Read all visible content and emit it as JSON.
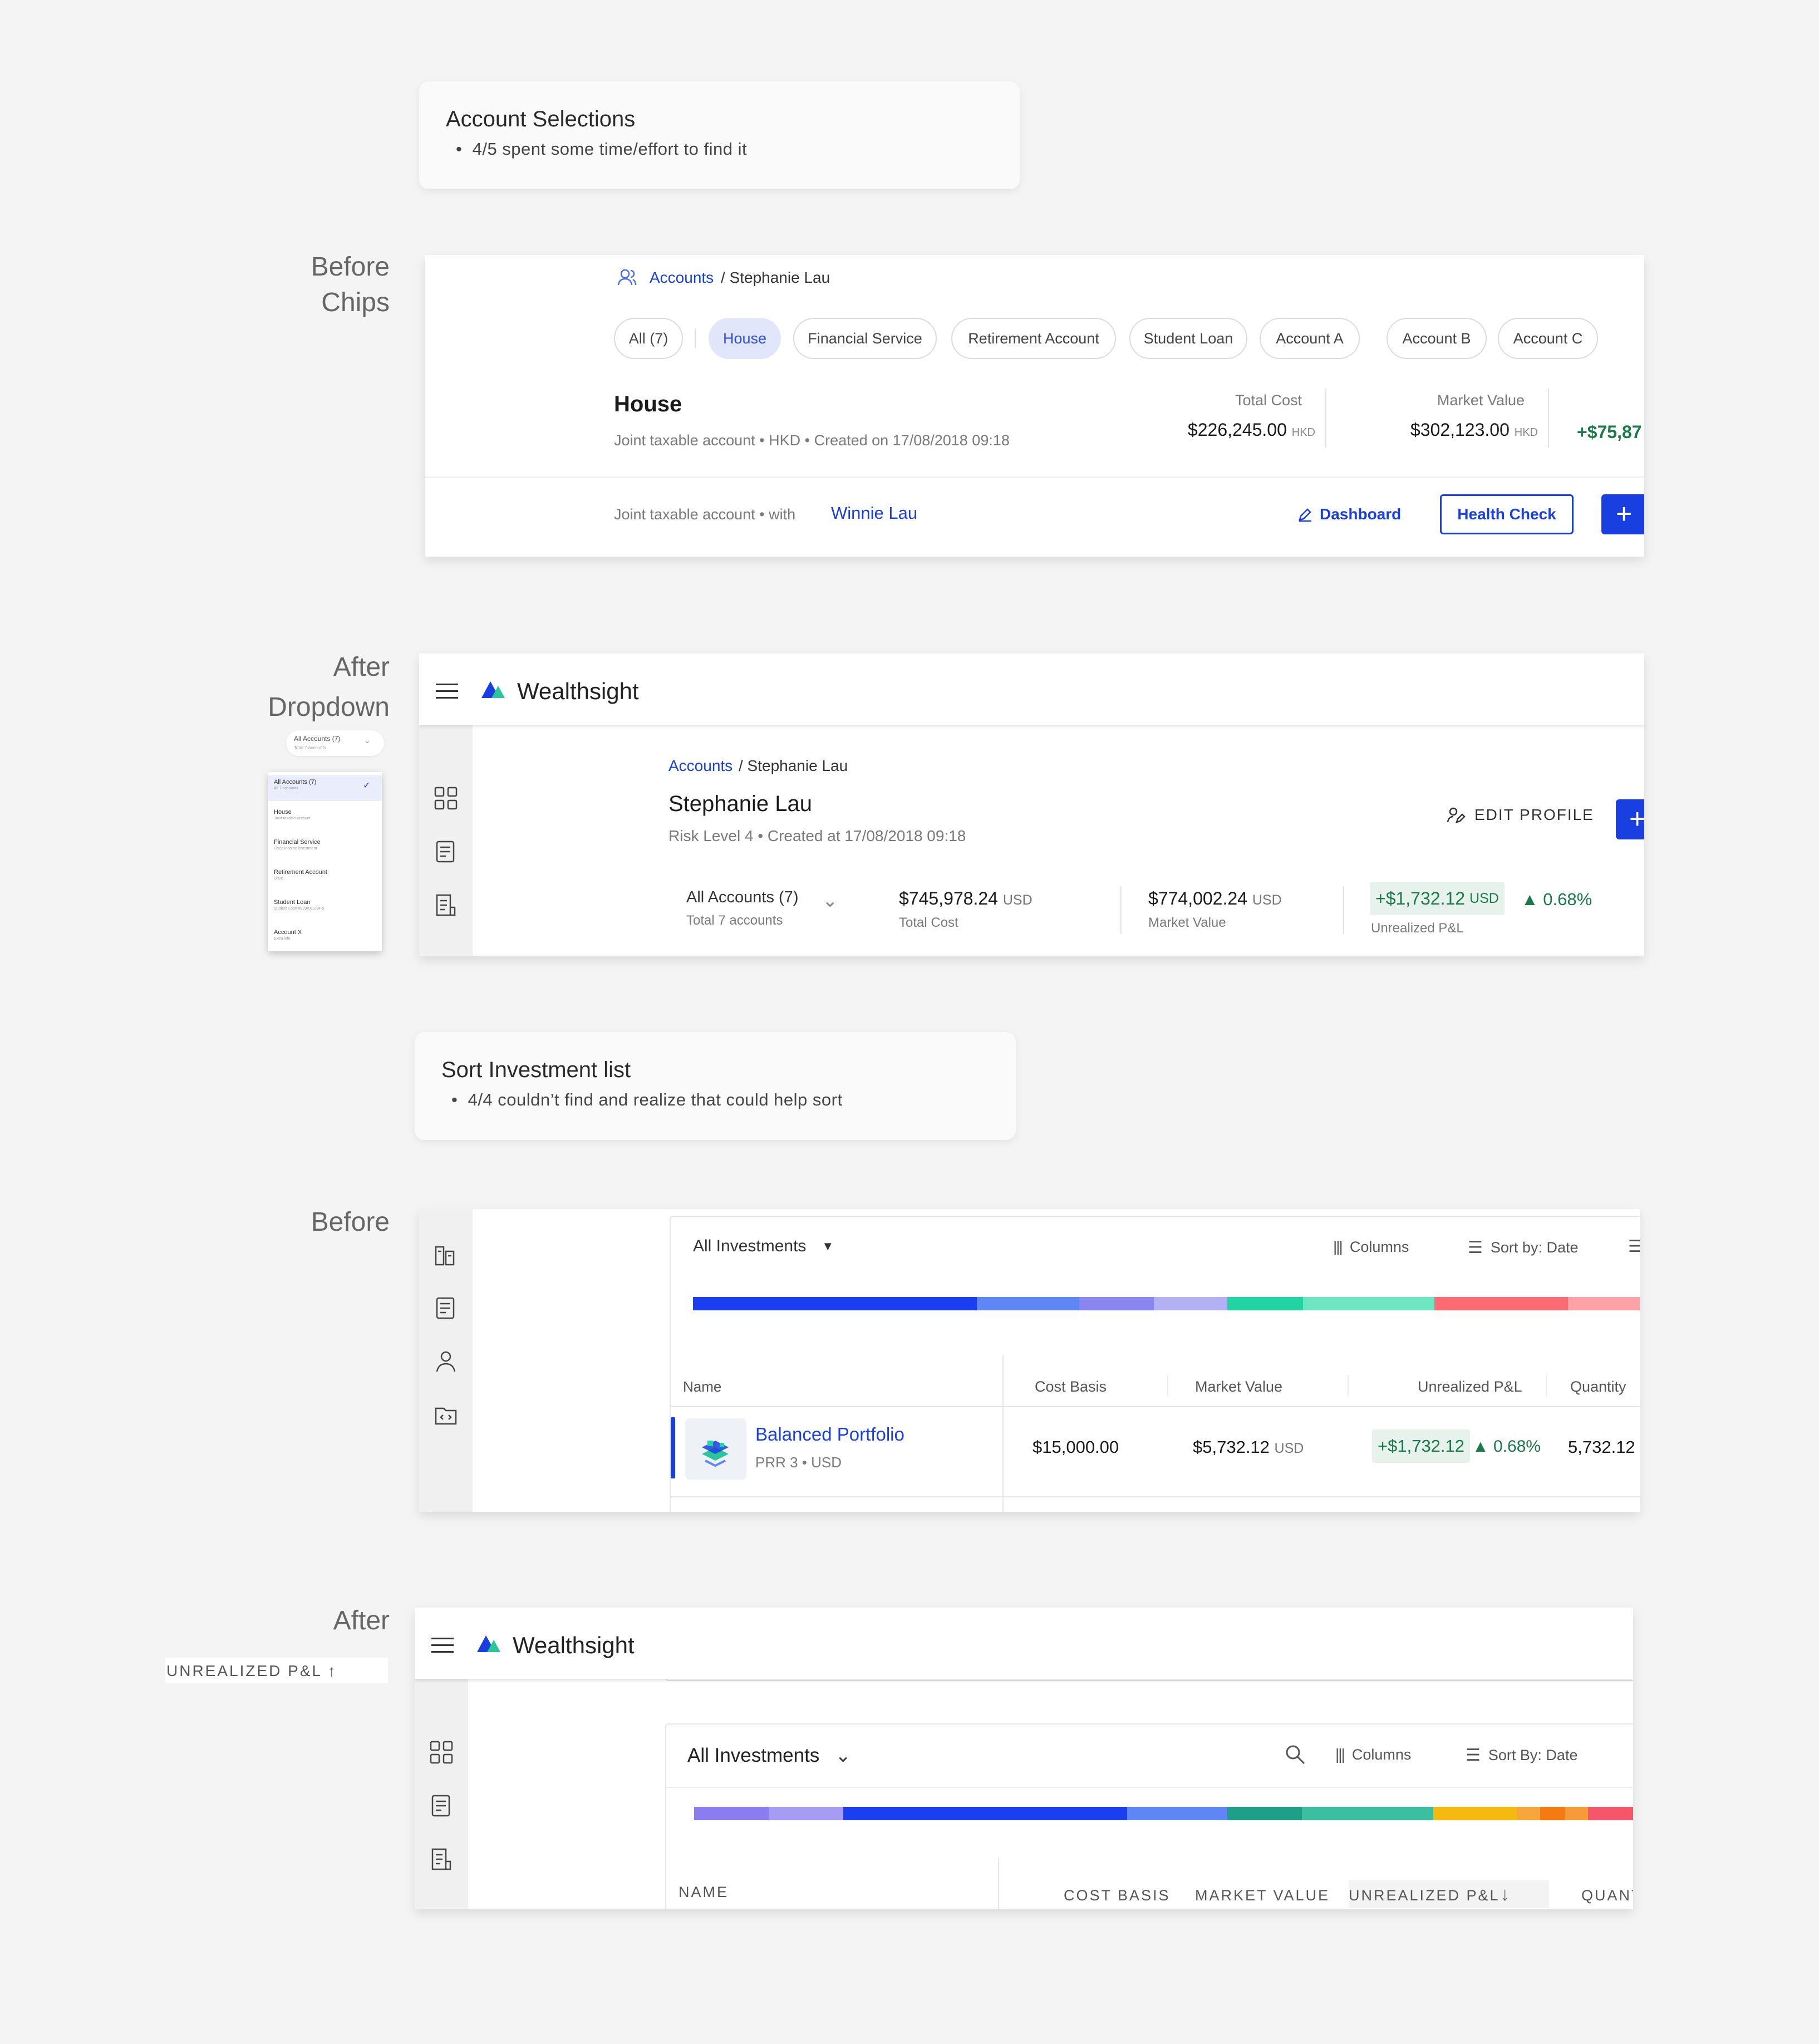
{
  "note1": {
    "title": "Account Selections",
    "bullet": "4/5 spent some time/effort to find it"
  },
  "note2": {
    "title": "Sort Investment list",
    "bullet": "4/4 couldn’t find and realize that could help sort"
  },
  "labels": {
    "before_chips_1": "Before",
    "before_chips_2": "Chips",
    "after_dropdown_1": "After",
    "after_dropdown_2": "Dropdown",
    "before_sort": "Before",
    "after_sort": "After",
    "sort_chip": "UNREALIZED P&L ↑"
  },
  "chips_panel": {
    "breadcrumb_link": "Accounts",
    "breadcrumb_rest": "/ Stephanie Lau",
    "chips": [
      "All (7)",
      "House",
      "Financial Service",
      "Retirement Account",
      "Student Loan",
      "Account A",
      "Account B",
      "Account C"
    ],
    "selected_chip": "House",
    "account_title": "House",
    "account_meta": "Joint taxable account • HKD • Created on 17/08/2018 09:18",
    "total_cost_label": "Total Cost",
    "total_cost_value": "$226,245.00",
    "total_cost_ccy": "HKD",
    "market_value_label": "Market Value",
    "market_value_value": "$302,123.00",
    "market_value_ccy": "HKD",
    "pnl_partial": "+$75,87",
    "footer_text": "Joint taxable account  •  with",
    "footer_link": "Winnie Lau",
    "dashboard_label": "Dashboard",
    "health_check_label": "Health Check",
    "add_label": "+"
  },
  "app": {
    "brand": "Wealthsight"
  },
  "dropdown_panel": {
    "breadcrumb_link": "Accounts",
    "breadcrumb_rest": "/ Stephanie Lau",
    "name": "Stephanie Lau",
    "meta": "Risk Level 4 • Created at 17/08/2018 09:18",
    "edit_profile_label": "EDIT PROFILE",
    "selector_title": "All Accounts (7)",
    "selector_sub": "Total 7 accounts",
    "total_cost_value": "$745,978.24",
    "total_cost_ccy": "USD",
    "total_cost_label": "Total Cost",
    "market_value_value": "$774,002.24",
    "market_value_ccy": "USD",
    "market_value_label": "Market Value",
    "pnl_value": "+$1,732.12",
    "pnl_ccy": "USD",
    "pnl_pct": "0.68%",
    "pnl_label": "Unrealized P&L"
  },
  "mini_dropdown": {
    "trigger_title": "All Accounts (7)",
    "trigger_sub": "Total 7 accounts",
    "items": [
      {
        "title": "All Accounts (7)",
        "sub": "All 7 accounts"
      },
      {
        "title": "House",
        "sub": "Joint taxable account"
      },
      {
        "title": "Financial Service",
        "sub": "Fixed income investment"
      },
      {
        "title": "Retirement Account",
        "sub": "Drive"
      },
      {
        "title": "Student Loan",
        "sub": "Student Loan 8929XX1234-5"
      },
      {
        "title": "Account X",
        "sub": "Extra info"
      }
    ]
  },
  "sort_before": {
    "filter_label": "All Investments",
    "columns_label": "Columns",
    "sort_label": "Sort by: Date",
    "headers": [
      "Name",
      "Cost Basis",
      "Market Value",
      "Unrealized P&L",
      "Quantity"
    ],
    "row": {
      "name": "Balanced Portfolio",
      "sub": "PRR 3 • USD",
      "cost_basis": "$15,000.00",
      "market_value": "$5,732.12",
      "market_ccy": "USD",
      "pnl": "+$1,732.12",
      "pnl_pct": "0.68%",
      "quantity": "5,732.12"
    },
    "bar_colors": [
      "#1b3ff0",
      "#5f86f5",
      "#8a86f0",
      "#b3b0f4",
      "#22d3a4",
      "#6ee6c2",
      "#fb6b74",
      "#fda3a8"
    ]
  },
  "sort_after": {
    "filter_label": "All Investments",
    "columns_label": "Columns",
    "sort_label": "Sort By: Date",
    "headers": [
      "NAME",
      "COST BASIS",
      "MARKET VALUE",
      "UNREALIZED P&L",
      "QUANT"
    ],
    "bar_colors": [
      "#8b7df1",
      "#a79cf3",
      "#1b3ff0",
      "#5f86f5",
      "#1ea088",
      "#3bbfa0",
      "#f5b90f",
      "#f7a63b",
      "#f57b10",
      "#f79b3a",
      "#f6566a"
    ]
  }
}
